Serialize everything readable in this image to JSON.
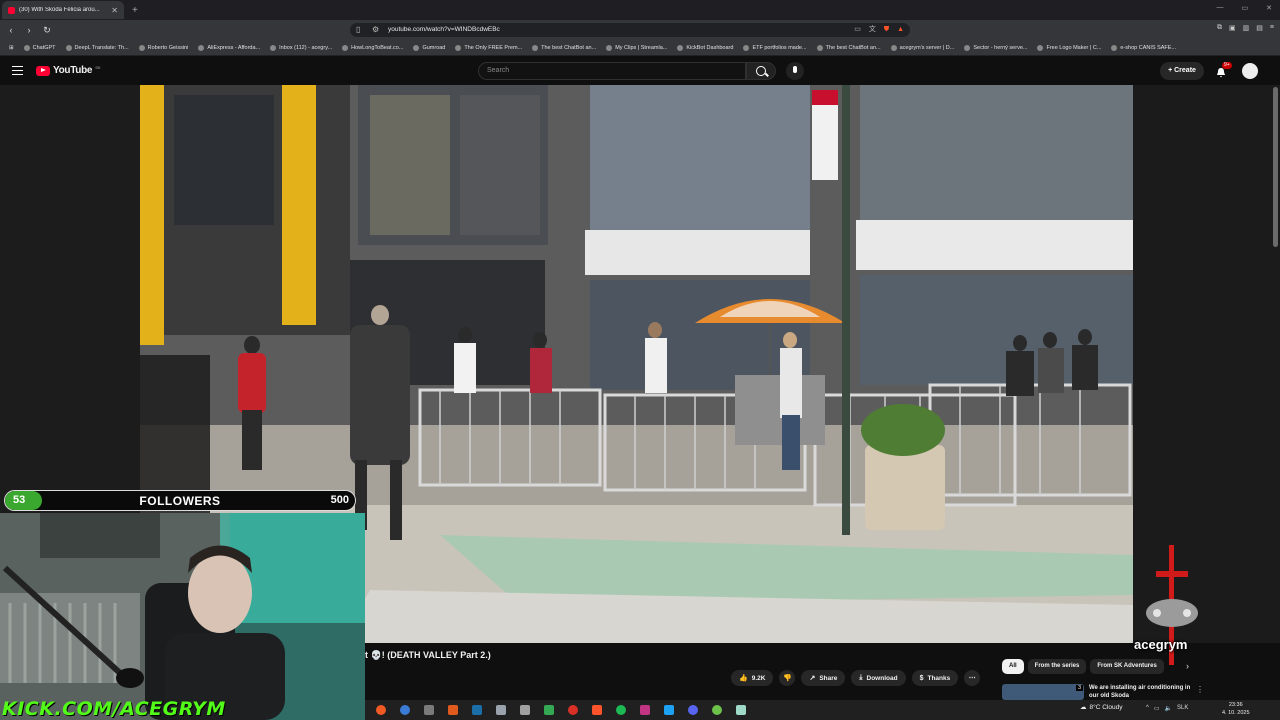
{
  "browser": {
    "tab_title": "(30) With Skoda Felicia arou...",
    "url": "youtube.com/watch?v=WINDBcdwEBc",
    "bookmarks": [
      "ChatGPT",
      "DeepL Translate: Th...",
      "Roberto Geissini",
      "AliExpress - Afforda...",
      "Inbox (112) - acegry...",
      "HowLongToBeat.co...",
      "Gumroad",
      "The Only FREE Prem...",
      "The best ChatBot an...",
      "My Clips | Streamla...",
      "KickBot Dashboard",
      "ETF portfolios made...",
      "The best ChatBot an...",
      "acegrym's server | D...",
      "Sector - herný serve...",
      "Free Logo Maker | C...",
      "e-shop CANIS SAFE..."
    ]
  },
  "youtube": {
    "logo_text": "YouTube",
    "region": "SK",
    "search_placeholder": "Search",
    "create_label": "Create",
    "notif_count": "9+",
    "video_title": "t 💀! (DEATH VALLEY Part 2.)",
    "likes": "9.2K",
    "share_label": "Share",
    "download_label": "Download",
    "thanks_label": "Thanks",
    "chips": [
      "All",
      "From the series",
      "From SK Adventures"
    ],
    "rec_index": "3",
    "rec_title": "We are installing air conditioning in our old Skoda"
  },
  "overlay": {
    "followers_current": "53",
    "followers_label": "FOLLOWERS",
    "followers_goal": "500",
    "followers_progress": 0.106,
    "kick_label": "KICK.COM/ACEGRYM",
    "channel_name": "acegrym"
  },
  "taskbar": {
    "weather": "8°C  Cloudy",
    "language": "SLK",
    "time": "23:36",
    "date": "4. 10. 2025"
  },
  "colors": {
    "brand_red": "#ff0033",
    "kick_green": "#53fc18",
    "progress_green": "#3aa82e"
  }
}
